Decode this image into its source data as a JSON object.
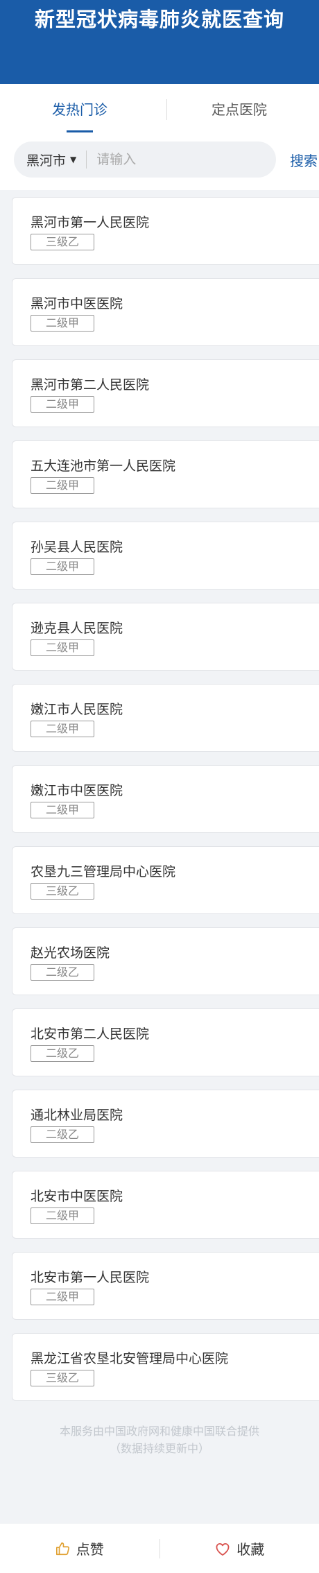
{
  "header": {
    "title": "新型冠状病毒肺炎就医查询"
  },
  "tabs": [
    {
      "label": "发热门诊",
      "active": true
    },
    {
      "label": "定点医院",
      "active": false
    }
  ],
  "search": {
    "city": "黑河市",
    "placeholder": "请输入",
    "value": "",
    "button_label": "搜索"
  },
  "hospitals": [
    {
      "name": "黑河市第一人民医院",
      "level": "三级乙"
    },
    {
      "name": "黑河市中医医院",
      "level": "二级甲"
    },
    {
      "name": "黑河市第二人民医院",
      "level": "二级甲"
    },
    {
      "name": "五大连池市第一人民医院",
      "level": "二级甲"
    },
    {
      "name": "孙吴县人民医院",
      "level": "二级甲"
    },
    {
      "name": "逊克县人民医院",
      "level": "二级甲"
    },
    {
      "name": "嫩江市人民医院",
      "level": "二级甲"
    },
    {
      "name": "嫩江市中医医院",
      "level": "二级甲"
    },
    {
      "name": "农垦九三管理局中心医院",
      "level": "三级乙"
    },
    {
      "name": "赵光农场医院",
      "level": "二级乙"
    },
    {
      "name": "北安市第二人民医院",
      "level": "二级乙"
    },
    {
      "name": "通北林业局医院",
      "level": "二级乙"
    },
    {
      "name": "北安市中医医院",
      "level": "二级甲"
    },
    {
      "name": "北安市第一人民医院",
      "level": "二级甲"
    },
    {
      "name": "黑龙江省农垦北安管理局中心医院",
      "level": "三级乙"
    }
  ],
  "footer": {
    "line1": "本服务由中国政府网和健康中国联合提供",
    "line2": "（数据持续更新中）"
  },
  "bottom_bar": {
    "like_label": "点赞",
    "like_icon": "thumbs-up-icon",
    "favorite_label": "收藏",
    "favorite_icon": "heart-icon"
  },
  "colors": {
    "brand_blue": "#1a5ca8",
    "favorite_red": "#d9534f",
    "like_orange": "#e0a030"
  }
}
